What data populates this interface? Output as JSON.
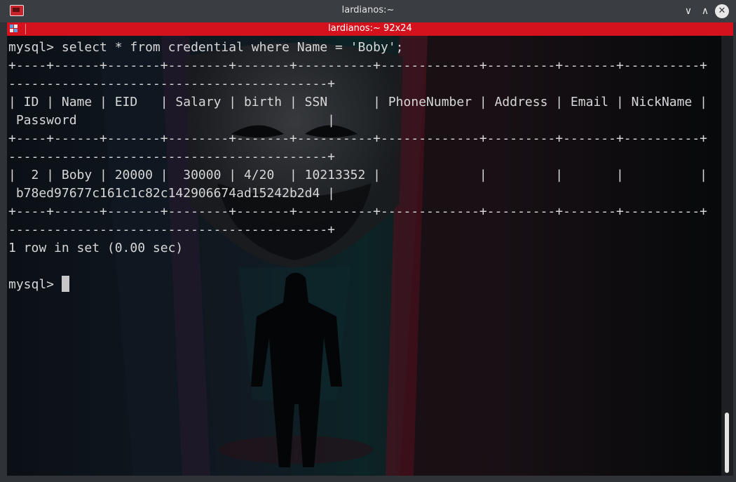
{
  "window": {
    "title": "lardianos:~",
    "minimize_glyph": "∨",
    "maximize_glyph": "∧",
    "close_glyph": "✕"
  },
  "session": {
    "title": "lardianos:~ 92x24"
  },
  "terminal": {
    "lines": [
      "mysql> select * from credential where Name = 'Boby';",
      "+----+------+-------+--------+-------+----------+-------------+---------+-------+----------+",
      "------------------------------------------+",
      "| ID | Name | EID   | Salary | birth | SSN      | PhoneNumber | Address | Email | NickName |",
      " Password                                 |",
      "+----+------+-------+--------+-------+----------+-------------+---------+-------+----------+",
      "------------------------------------------+",
      "|  2 | Boby | 20000 |  30000 | 4/20  | 10213352 |             |         |       |          |",
      " b78ed97677c161c1c82c142906674ad15242b2d4 |",
      "+----+------+-------+--------+-------+----------+-------------+---------+-------+----------+",
      "------------------------------------------+",
      "1 row in set (0.00 sec)",
      "",
      "mysql> "
    ]
  },
  "theme": {
    "session_bar_color": "#d4121d",
    "terminal_bg": "#070809",
    "text_color": "#d7d7d7"
  }
}
